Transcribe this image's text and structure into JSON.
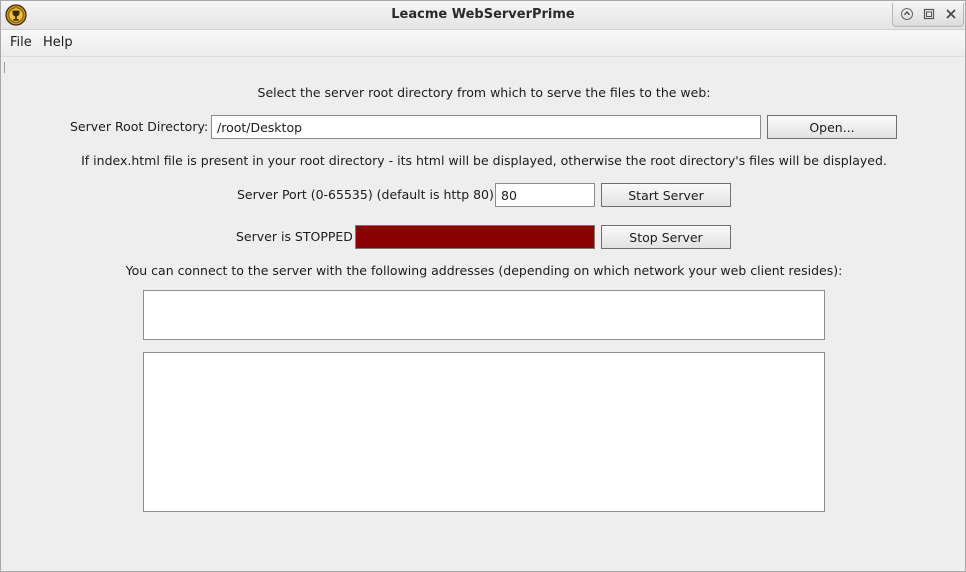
{
  "window": {
    "title": "Leacme WebServerPrime",
    "app_icon": "trophy-icon",
    "controls": [
      "restore-icon",
      "maximize-icon",
      "close-icon"
    ]
  },
  "menu": {
    "file": "File",
    "help": "Help"
  },
  "main": {
    "select_prompt": "Select the server root directory from which to serve the files to the web:",
    "root_dir_label": "Server Root Directory:",
    "root_dir_value": "/root/Desktop",
    "open_button": "Open...",
    "index_note": "If index.html file is present in your root directory - its html will be displayed, otherwise the root directory's files will be displayed.",
    "port_label": "Server Port (0-65535) (default is http 80):",
    "port_value": "80",
    "start_button": "Start Server",
    "status_label": "Server is STOPPED",
    "status_color": "#8b0000",
    "stop_button": "Stop Server",
    "connect_note": "You can connect to the server with the following addresses (depending on which network your web client resides):",
    "addresses_text": "",
    "log_text": ""
  }
}
